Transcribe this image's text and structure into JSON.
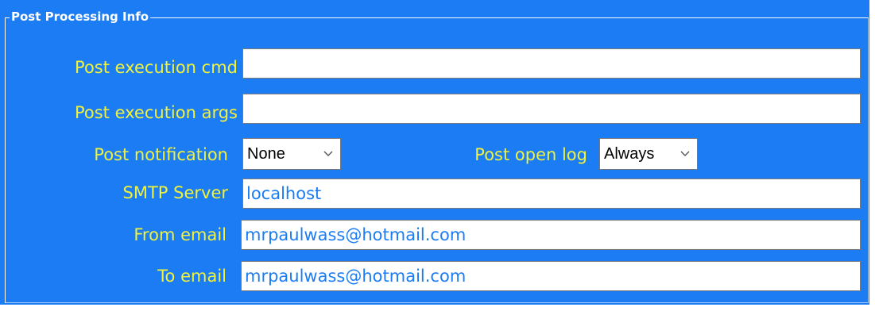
{
  "group": {
    "title": "Post Processing Info"
  },
  "fields": {
    "post_exec_cmd": {
      "label": "Post execution cmd",
      "value": ""
    },
    "post_exec_args": {
      "label": "Post execution args",
      "value": ""
    },
    "post_notification": {
      "label": "Post notification",
      "selected": "None"
    },
    "post_open_log": {
      "label": "Post open log",
      "selected": "Always"
    },
    "smtp_server": {
      "label": "SMTP Server",
      "value": "localhost"
    },
    "from_email": {
      "label": "From email",
      "value": "mrpaulwass@hotmail.com"
    },
    "to_email": {
      "label": "To email",
      "value": "mrpaulwass@hotmail.com"
    }
  },
  "icons": {
    "dropdown": "chevron-down-icon"
  },
  "colors": {
    "panel_background": "#1b7cf3",
    "label_text": "#f0f23c",
    "input_text": "#1b7cf3",
    "legend_text": "#ffffff"
  }
}
